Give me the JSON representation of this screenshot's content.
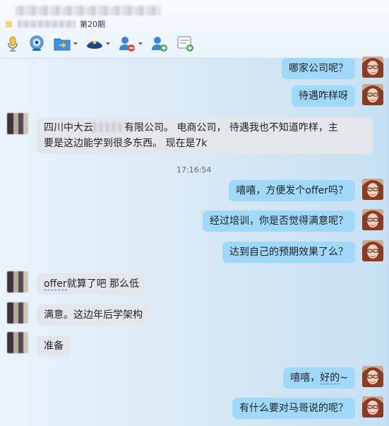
{
  "header": {
    "group_suffix": "第20期"
  },
  "toolbar": {
    "icons": [
      "microphone-icon",
      "camera-icon",
      "folder-transfer-icon",
      "police-hat-icon",
      "remove-user-icon",
      "add-user-icon",
      "add-note-icon"
    ]
  },
  "messages": [
    {
      "dir": "out",
      "text": "哪家公司呢？"
    },
    {
      "dir": "out",
      "text": "待遇咋样呀"
    },
    {
      "dir": "in",
      "line1_a": "四川中大云",
      "line1_b": "有限公司。  电商公司， 待遇我也不知道咋样，主",
      "line2": "要是这边能学到很多东西。  现在是7k"
    },
    {
      "dir": "time",
      "text": "17:16:54"
    },
    {
      "dir": "out",
      "text": "嘻嘻，方便发个offer吗？"
    },
    {
      "dir": "out",
      "text": "经过培训，你是否觉得满意呢？"
    },
    {
      "dir": "out",
      "text": "达到自己的预期效果了么？"
    },
    {
      "dir": "in",
      "text_a": "offer",
      "text_b": "就算了吧  那么低"
    },
    {
      "dir": "in",
      "text": "满意。这边年后学架构"
    },
    {
      "dir": "in",
      "text": "准备"
    },
    {
      "dir": "out",
      "text_a": "嘻嘻，",
      "text_b": "好的",
      "text_c": "~"
    },
    {
      "dir": "out",
      "text": "有什么要对马哥说的呢？"
    }
  ]
}
